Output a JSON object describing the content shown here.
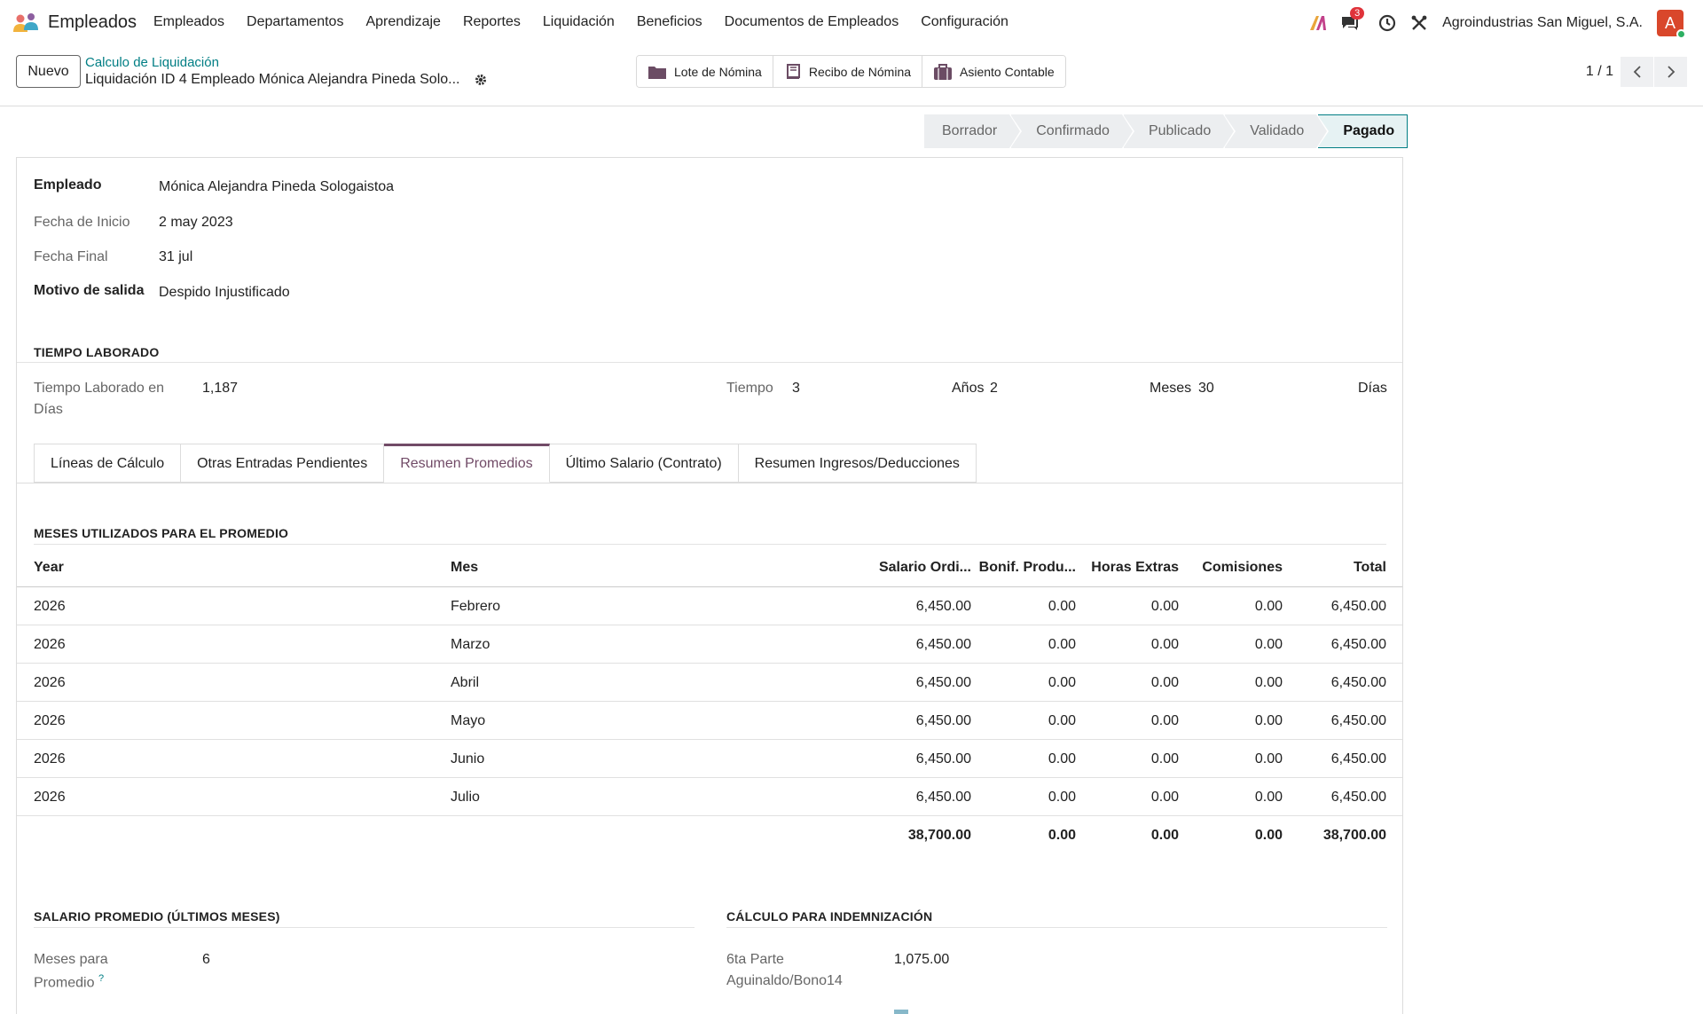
{
  "app": {
    "name": "Empleados",
    "logo_icon": "people-icon"
  },
  "menu": [
    "Empleados",
    "Departamentos",
    "Aprendizaje",
    "Reportes",
    "Liquidación",
    "Beneficios",
    "Documentos de Empleados",
    "Configuración"
  ],
  "nav": {
    "messages_count": "3",
    "company": "Agroindustrias San Miguel, S.A.",
    "avatar_letter": "A"
  },
  "control": {
    "new_label": "Nuevo",
    "breadcrumb_parent": "Calculo de Liquidación",
    "breadcrumb_current": "Liquidación ID 4 Empleado Mónica Alejandra Pineda Solo...",
    "smart_buttons": [
      "Lote de Nómina",
      "Recibo de Nómina",
      "Asiento Contable"
    ],
    "pager": "1 / 1"
  },
  "status": {
    "stages": [
      "Borrador",
      "Confirmado",
      "Publicado",
      "Validado",
      "Pagado"
    ],
    "active": "Pagado"
  },
  "form": {
    "empleado_label": "Empleado",
    "empleado_value": "Mónica Alejandra Pineda Sologaistoa",
    "fecha_inicio_label": "Fecha de Inicio",
    "fecha_inicio_value": "2 may 2023",
    "fecha_final_label": "Fecha Final",
    "fecha_final_value": "31 jul",
    "motivo_label": "Motivo de salida",
    "motivo_value": "Despido Injustificado"
  },
  "tiempo": {
    "title": "TIEMPO LABORADO",
    "dias_label_1": "Tiempo Laborado en",
    "dias_label_2": "Días",
    "dias_value": "1,187",
    "tiempo_label": "Tiempo",
    "anios_value": "3",
    "anios_label": "Años",
    "meses_value": "2",
    "meses_label": "Meses",
    "dias2_value": "30",
    "dias2_label": "Días"
  },
  "tabs": [
    "Líneas de Cálculo",
    "Otras Entradas Pendientes",
    "Resumen Promedios",
    "Último Salario (Contrato)",
    "Resumen Ingresos/Deducciones"
  ],
  "active_tab": "Resumen Promedios",
  "promedio_table": {
    "title": "MESES UTILIZADOS PARA EL PROMEDIO",
    "headers": [
      "Year",
      "Mes",
      "Salario Ordi...",
      "Bonif. Produ...",
      "Horas Extras",
      "Comisiones",
      "Total"
    ],
    "rows": [
      [
        "2026",
        "Febrero",
        "6,450.00",
        "0.00",
        "0.00",
        "0.00",
        "6,450.00"
      ],
      [
        "2026",
        "Marzo",
        "6,450.00",
        "0.00",
        "0.00",
        "0.00",
        "6,450.00"
      ],
      [
        "2026",
        "Abril",
        "6,450.00",
        "0.00",
        "0.00",
        "0.00",
        "6,450.00"
      ],
      [
        "2026",
        "Mayo",
        "6,450.00",
        "0.00",
        "0.00",
        "0.00",
        "6,450.00"
      ],
      [
        "2026",
        "Junio",
        "6,450.00",
        "0.00",
        "0.00",
        "0.00",
        "6,450.00"
      ],
      [
        "2026",
        "Julio",
        "6,450.00",
        "0.00",
        "0.00",
        "0.00",
        "6,450.00"
      ]
    ],
    "totals": [
      "38,700.00",
      "0.00",
      "0.00",
      "0.00",
      "38,700.00"
    ]
  },
  "salario_promedio": {
    "title": "SALARIO PROMEDIO (ÚLTIMOS MESES)",
    "meses_label_1": "Meses para",
    "meses_label_2": "Promedio",
    "help_mark": "?",
    "meses_value": "6"
  },
  "indemnizacion": {
    "title": "CÁLCULO PARA INDEMNIZACIÓN",
    "sexta_label_1": "6ta Parte",
    "sexta_label_2": "Aguinaldo/Bono14",
    "sexta_value": "1,075.00"
  },
  "colors": {
    "accent": "#714b67",
    "link": "#017e84",
    "badge": "#e0333a",
    "avatar": "#d9472b"
  }
}
